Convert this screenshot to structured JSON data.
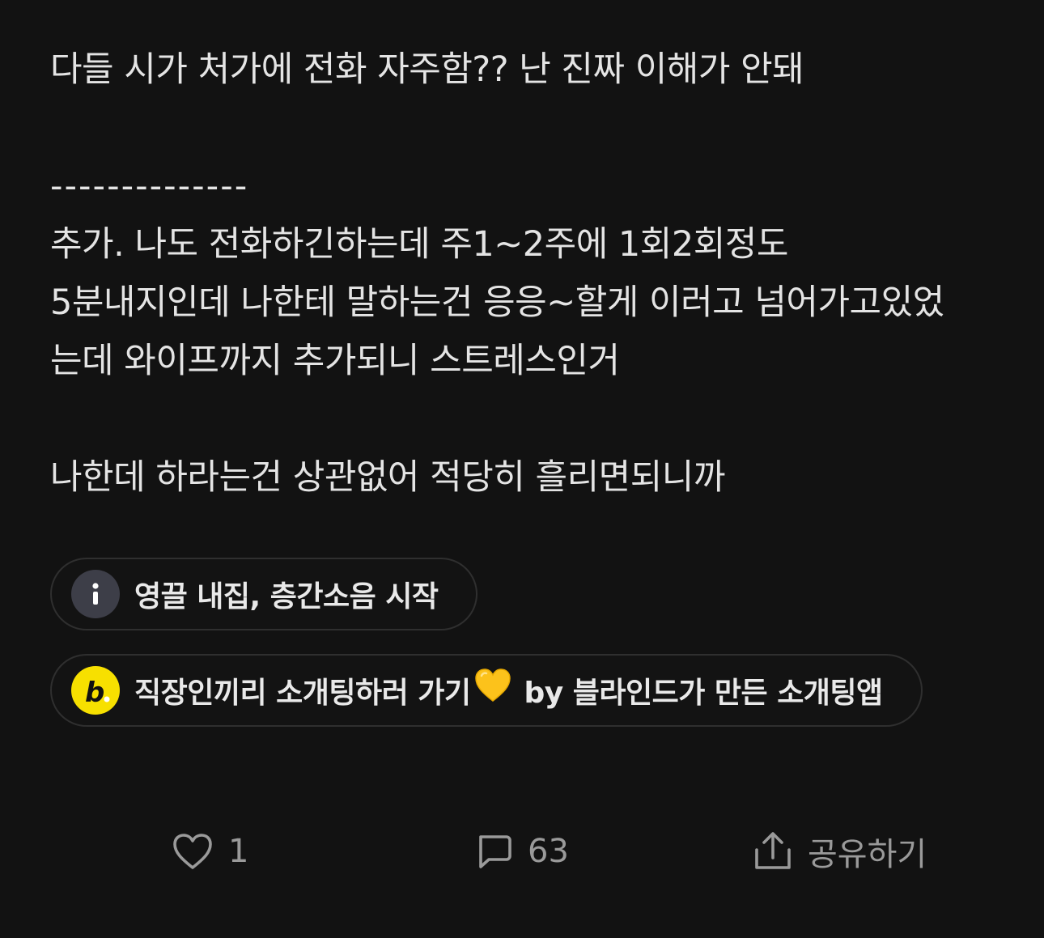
{
  "post": {
    "title": "다들 시가 처가에 전화 자주함?? 난 진짜 이해가 안돼",
    "divider": "--------------",
    "lines": [
      "추가. 나도 전화하긴하는데 주1~2주에 1회2회정도",
      "5분내지인데 나한테 말하는건 응응~할게 이러고 넘어가고있었",
      "는데 와이프까지 추가되니 스트레스인거"
    ],
    "closing": "나한데 하라는건 상관없어 적당히 흘리면되니까"
  },
  "chips": {
    "info": {
      "icon": "info-icon",
      "label": "영끌 내집, 층간소음 시작"
    },
    "ad": {
      "icon": "blind-dating-logo-icon",
      "label_main": "직장인끼리 소개팅하러 가기",
      "emoji": "yellow-heart-icon",
      "label_by": "by 블라인드가 만든 소개팅앱"
    }
  },
  "actions": {
    "like": {
      "icon": "heart-outline-icon",
      "count": "1"
    },
    "comment": {
      "icon": "speech-bubble-icon",
      "count": "63"
    },
    "share": {
      "icon": "share-upload-icon",
      "label": "공유하기"
    }
  },
  "colors": {
    "background": "#121212",
    "text": "#e4e4e4",
    "muted": "#9a9a9a",
    "chip_border": "#2f2f2f",
    "info_icon_bg": "#3d3e48",
    "blind_yellow": "#f7e000"
  }
}
